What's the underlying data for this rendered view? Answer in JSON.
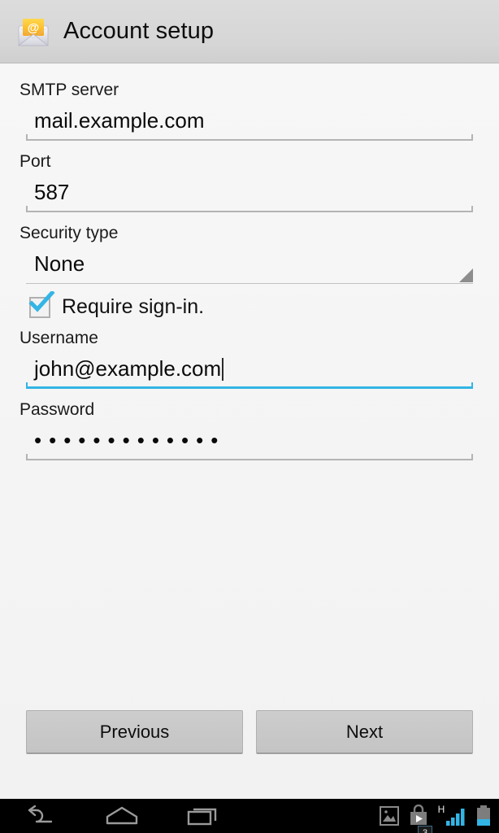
{
  "header": {
    "title": "Account setup",
    "icon": "email-at-envelope-icon"
  },
  "form": {
    "fields": [
      {
        "label": "SMTP server",
        "value": "mail.example.com",
        "focused": false,
        "type": "text"
      },
      {
        "label": "Port",
        "value": "587",
        "focused": false,
        "type": "text"
      },
      {
        "label": "Security type",
        "value": "None",
        "focused": false,
        "type": "spinner"
      },
      {
        "label": "Username",
        "value": "john@example.com",
        "focused": true,
        "type": "text"
      },
      {
        "label": "Password",
        "value": "•••••••••••••",
        "focused": false,
        "type": "password"
      }
    ],
    "checkbox": {
      "label": "Require sign-in.",
      "checked": true
    }
  },
  "buttons": {
    "previous": "Previous",
    "next": "Next"
  },
  "navbar": {
    "back": "back-icon",
    "home": "home-icon",
    "recents": "recents-icon",
    "status": {
      "gallery": "gallery-icon",
      "play_store": "play-store-icon",
      "play_store_badge": "3",
      "network_type": "H",
      "signal": "signal-bars-icon",
      "battery": "battery-icon"
    }
  },
  "colors": {
    "accent": "#33b5e5",
    "header_bg": "#d6d6d6",
    "body_bg": "#f4f4f4",
    "button_bg": "#c6c6c6",
    "underline": "#b4b4b4",
    "navbar_bg": "#000000"
  }
}
